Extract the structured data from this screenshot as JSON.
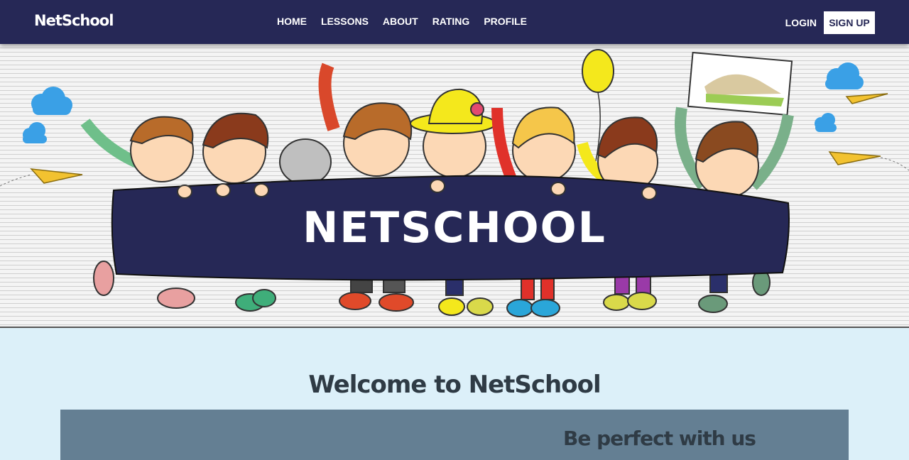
{
  "nav": {
    "brand": "NetSchool",
    "links": [
      "HOME",
      "LESSONS",
      "ABOUT",
      "RATING",
      "PROFILE"
    ],
    "login": "LOGIN",
    "signup": "SIGN UP"
  },
  "hero": {
    "banner_text": "NETSCHOOL"
  },
  "welcome": {
    "title": "Welcome to NetSchool"
  },
  "panel": {
    "title": "Be perfect with us"
  },
  "colors": {
    "navbar": "#262856",
    "page_background": "#dcf0f9",
    "panel": "#647f93",
    "heading_text": "#2f3b45"
  }
}
